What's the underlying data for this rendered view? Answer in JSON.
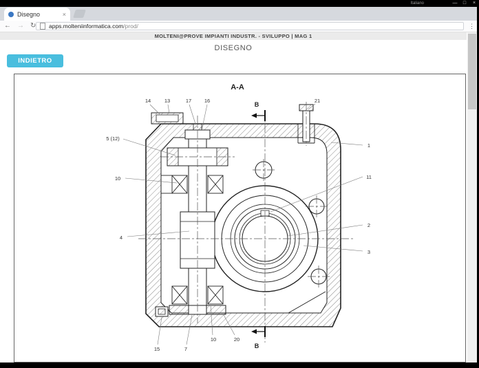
{
  "window": {
    "language": "Italiano",
    "minimize": "—",
    "maximize": "□",
    "close": "×"
  },
  "browser": {
    "tab_title": "Disegno",
    "icons": {
      "tab_close": "×",
      "back": "←",
      "forward": "→",
      "refresh": "↻",
      "menu": "⋮"
    },
    "url_host": "apps.molteniinformatica.com",
    "url_path": "/prod/"
  },
  "page": {
    "app_header": "MOLTENI@PROVE IMPIANTI INDUSTR. - SVILUPPO | MAG 1",
    "title": "DISEGNO",
    "back_button": "INDIETRO"
  },
  "colors": {
    "accent_button": "#49bede",
    "tab_favicon": "#3b78c3"
  },
  "drawing": {
    "view_label": "A-A",
    "section_top": "B",
    "section_bottom": "B",
    "callouts": {
      "c14": "14",
      "c13": "13",
      "c17": "17",
      "c16": "16",
      "c21": "21",
      "c5": "5 (12)",
      "c10a": "10",
      "c1": "1",
      "c11": "11",
      "c4": "4",
      "c2": "2",
      "c3": "3",
      "c15": "15",
      "c7": "7",
      "c10b": "10",
      "c20": "20"
    }
  }
}
